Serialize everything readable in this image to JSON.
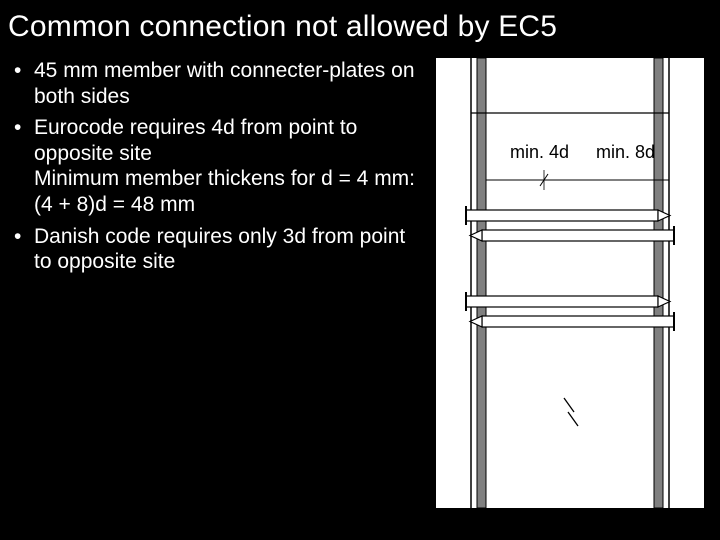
{
  "title": "Common connection not allowed by EC5",
  "bullets": [
    {
      "lines": [
        "45 mm member with connecter-plates on both sides"
      ]
    },
    {
      "lines": [
        "Eurocode requires 4d from point to opposite site",
        "Minimum member thickens for d = 4 mm:",
        "(4 + 8)d = 48 mm"
      ]
    },
    {
      "lines": [
        "Danish code requires only 3d from point to opposite site"
      ]
    }
  ],
  "diagram": {
    "label_left": "min. 4d",
    "label_right": "min. 8d"
  }
}
